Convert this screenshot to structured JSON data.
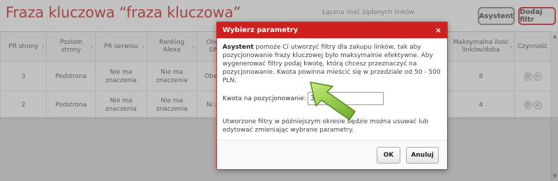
{
  "header": {
    "title": "Fraza kluczowa “fraza kluczowa”",
    "total_links_label": "Łączna ilość żądanych linków",
    "asystent_label": "Asystent",
    "add_filter_label": "Dodaj filtr"
  },
  "table": {
    "columns": [
      {
        "label": "PR strony",
        "help": "?"
      },
      {
        "label": "Poziom strony",
        "help": "?"
      },
      {
        "label": "PR serwisu",
        "help": "?"
      },
      {
        "label": "Ranking Alexa",
        "help": "?"
      },
      {
        "label": "Obec DM",
        "help": ""
      },
      {
        "label": "",
        "help": ""
      },
      {
        "label": "Maksymalna ilość linków/doba",
        "help": "?"
      },
      {
        "label": "Czynność",
        "help": ""
      }
    ],
    "rows": [
      {
        "pr_strony": "3",
        "poziom": "Podstrona",
        "pr_serwisu": "Nie ma znaczenia",
        "alexa": "Nie ma znaczenia",
        "obec": "Obe D",
        "max": "8"
      },
      {
        "pr_strony": "2",
        "poziom": "Podstrona",
        "pr_serwisu": "Nie ma znaczenia",
        "alexa": "Nie ma znaczenia",
        "obec": "Ni zn",
        "max": "4"
      }
    ]
  },
  "modal": {
    "title": "Wybierz parametry",
    "close_glyph": "×",
    "intro_bold": "Asystent",
    "intro_text": " pomoże Ci utworzyć filtry dla zakupu linków, tak aby pozycjonowanie frazy kluczowej było maksymalnie efektywne. Aby wygenerować filtry podaj kwotę, którą chcesz przeznaczyć na pozycjonowanie. Kwota powinna mieścić się w przedziale od 50 - 500 PLN.",
    "amount_label": "Kwota na pozycjonowanie:",
    "amount_value": "300",
    "note": "Utworzone filtry w późniejszym okresie będzie można usuwać lub edytować zmieniając wybrane parametry.",
    "ok_label": "OK",
    "cancel_label": "Anuluj"
  },
  "icons": {
    "settings": "gear-icon",
    "remove": "close-icon",
    "arrow": "arrow-pointer-icon"
  },
  "colors": {
    "accent_red": "#cf2020",
    "arrow_green": "#8cc63f"
  }
}
